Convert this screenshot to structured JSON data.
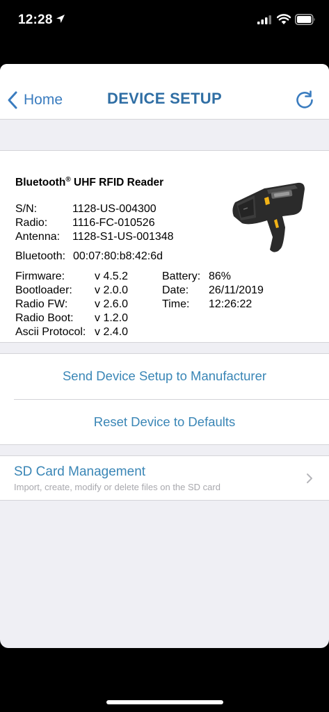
{
  "status_bar": {
    "time": "12:28",
    "icons": [
      "location-arrow-icon",
      "signal-icon",
      "wifi-icon",
      "battery-icon"
    ]
  },
  "navbar": {
    "back_label": "Home",
    "title": "DEVICE SETUP",
    "refresh_icon": "refresh-icon",
    "accent_color": "#3a7cbf"
  },
  "device": {
    "title": "Bluetooth",
    "title_reg": "®",
    "title_rest": " UHF RFID Reader",
    "image": "rfid-reader-gun-image",
    "serial_label": "S/N:",
    "serial_value": "1128-US-004300",
    "radio_label": "Radio:",
    "radio_value": "1116-FC-010526",
    "antenna_label": "Antenna:",
    "antenna_value": "1128-S1-US-001348",
    "bluetooth_label": "Bluetooth:",
    "bluetooth_value": "00:07:80:b8:42:6d",
    "firmware_label": "Firmware:",
    "firmware_value": "v 4.5.2",
    "bootloader_label": "Bootloader:",
    "bootloader_value": "v 2.0.0",
    "radio_fw_label": "Radio FW:",
    "radio_fw_value": "v 2.6.0",
    "radio_boot_label": "Radio Boot:",
    "radio_boot_value": "v 1.2.0",
    "ascii_label": "Ascii Protocol:",
    "ascii_value": "v 2.4.0",
    "battery_label": "Battery:",
    "battery_value": "86%",
    "date_label": "Date:",
    "date_value": "26/11/2019",
    "time_label": "Time:",
    "time_value": "12:26:22"
  },
  "actions": {
    "send_setup": "Send Device Setup to Manufacturer",
    "reset_defaults": "Reset Device to Defaults"
  },
  "sd_card": {
    "title": "SD Card Management",
    "subtitle": "Import, create, modify or delete files on the SD card"
  }
}
